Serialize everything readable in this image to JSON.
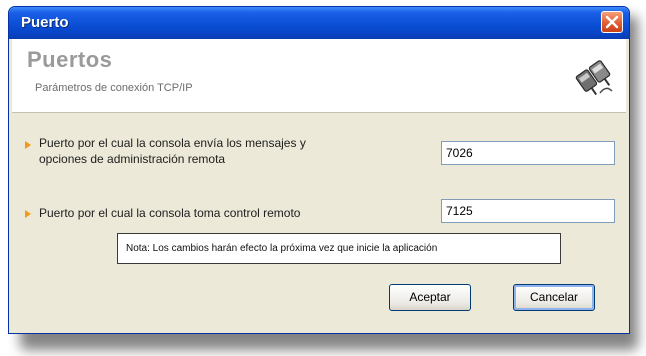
{
  "window": {
    "title": "Puerto",
    "close_icon": "close-icon"
  },
  "header": {
    "title": "Puertos",
    "subtitle": "Parámetros de conexión TCP/IP",
    "icon": "network-plugs-icon"
  },
  "fields": [
    {
      "label_line1": "Puerto por el cual la consola envía los mensajes y",
      "label_line2": "opciones de administración remota",
      "value": "7026"
    },
    {
      "label_line1": "Puerto por el cual la consola toma control remoto",
      "value": "7125"
    }
  ],
  "note": "Nota: Los cambios harán efecto la próxima vez que inicie la aplicación",
  "buttons": {
    "accept_label": "Aceptar",
    "cancel_label": "Cancelar"
  },
  "colors": {
    "titlebar": "#0a4fd6",
    "window_bg": "#ece9d8",
    "bullet": "#f09a1a",
    "close": "#e0582c"
  }
}
